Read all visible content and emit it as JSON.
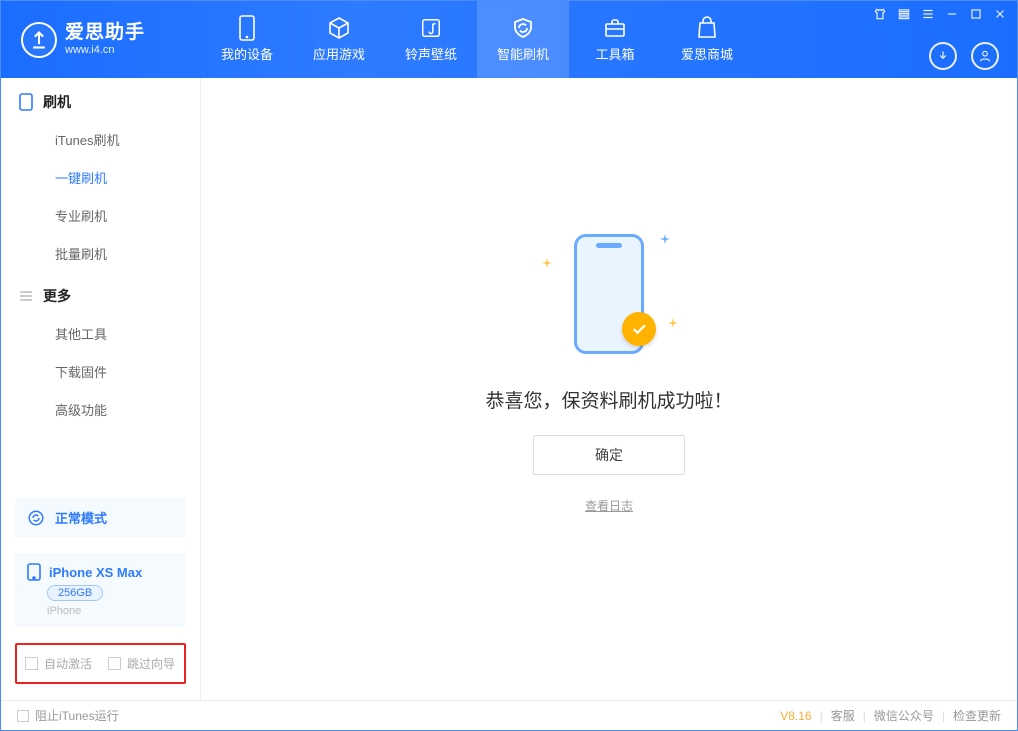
{
  "brand": {
    "name": "爱思助手",
    "url": "www.i4.cn"
  },
  "nav": {
    "items": [
      {
        "label": "我的设备"
      },
      {
        "label": "应用游戏"
      },
      {
        "label": "铃声壁纸"
      },
      {
        "label": "智能刷机"
      },
      {
        "label": "工具箱"
      },
      {
        "label": "爱思商城"
      }
    ],
    "active_index": 3
  },
  "sidebar": {
    "group1": {
      "title": "刷机",
      "items": [
        "iTunes刷机",
        "一键刷机",
        "专业刷机",
        "批量刷机"
      ],
      "active_index": 1
    },
    "group2": {
      "title": "更多",
      "items": [
        "其他工具",
        "下载固件",
        "高级功能"
      ]
    }
  },
  "mode": {
    "label": "正常模式"
  },
  "device": {
    "name": "iPhone XS Max",
    "capacity": "256GB",
    "type": "iPhone"
  },
  "checks": {
    "auto_activate": "自动激活",
    "skip_guide": "跳过向导"
  },
  "main": {
    "headline": "恭喜您，保资料刷机成功啦！",
    "ok": "确定",
    "log": "查看日志"
  },
  "footer": {
    "block_itunes": "阻止iTunes运行",
    "version": "V8.16",
    "links": [
      "客服",
      "微信公众号",
      "检查更新"
    ]
  }
}
